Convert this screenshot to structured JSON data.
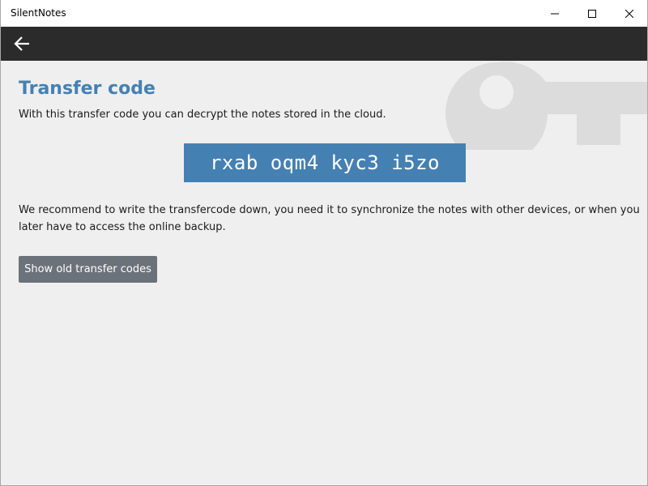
{
  "window": {
    "title": "SilentNotes",
    "controls": [
      "minimize-icon",
      "maximize-icon",
      "close-icon"
    ]
  },
  "appbar": {
    "back_icon": "arrow-left-icon"
  },
  "page": {
    "heading": "Transfer code",
    "intro": "With this transfer code you can decrypt the notes stored in the cloud.",
    "transfer_code": "rxab oqm4 kyc3 i5zo",
    "recommendation": "We recommend to write the transfercode down, you need it to synchronize the notes with other devices, or when you later have to access the online backup.",
    "show_old_codes_label": "Show old transfer codes",
    "decoration_icon": "key-icon"
  },
  "colors": {
    "accent": "#4580b3",
    "appbar": "#2b2b2b",
    "background": "#efefef",
    "button": "#6c7279",
    "watermark": "#dcdcdc"
  }
}
